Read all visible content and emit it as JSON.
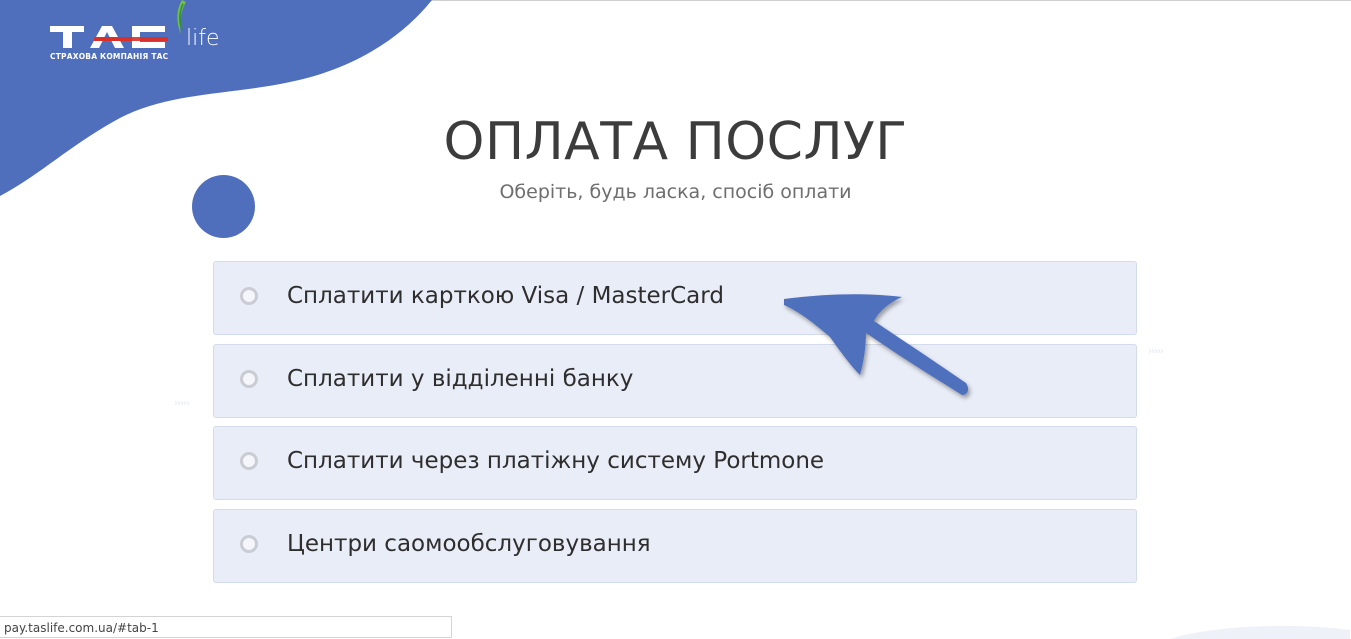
{
  "colors": {
    "brand_blue": "#4f6fbd",
    "option_bg": "#e9edf7",
    "title": "#3c3c3c",
    "subtitle": "#6e6e6e"
  },
  "logo": {
    "mark_text": "TAC",
    "company_line": "СТРАХОВА КОМПАНІЯ ТАС",
    "life_text": "life"
  },
  "page": {
    "title": "ОПЛАТА ПОСЛУГ",
    "subtitle": "Оберіть, будь ласка, спосіб оплати"
  },
  "payment_options": [
    {
      "label": "Сплатити карткою Visa / MasterCard",
      "selected": false
    },
    {
      "label": "Сплатити у відділенні банку",
      "selected": false
    },
    {
      "label": "Сплатити через платіжну систему Portmone",
      "selected": false
    },
    {
      "label": "Центри саомообслуговування",
      "selected": false
    }
  ],
  "status_bar": {
    "url": "pay.taslife.com.ua/#tab-1"
  },
  "icons": {
    "annotation": "hand-drawn-arrow-icon",
    "radio": "radio-unchecked-icon"
  }
}
